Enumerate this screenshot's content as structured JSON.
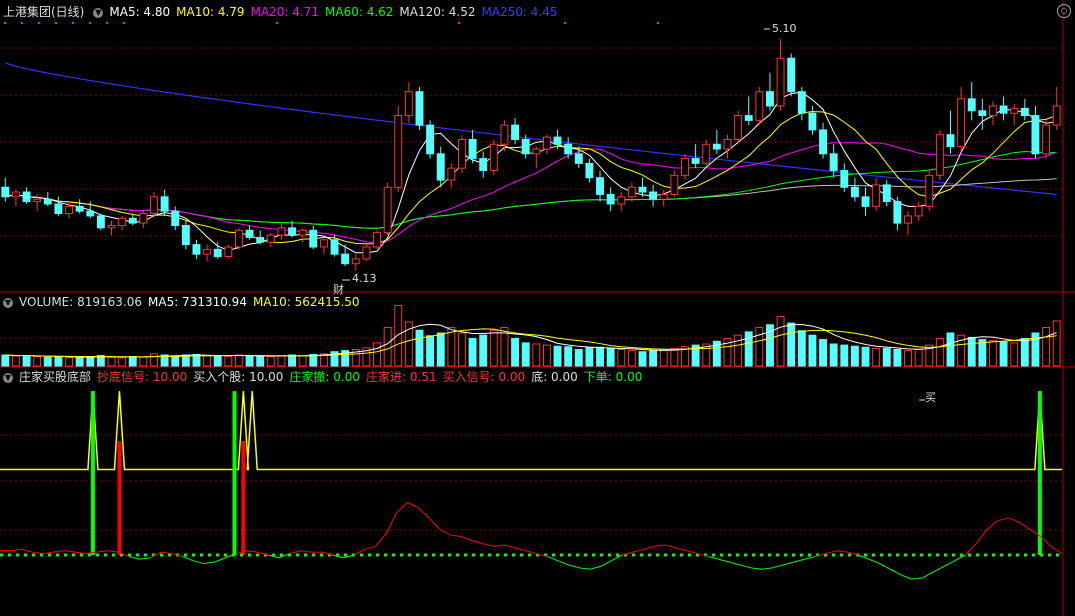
{
  "colors": {
    "up": "#ff3232",
    "down": "#54ffff",
    "ma5": "#ffffff",
    "ma10": "#ffff00",
    "ma20": "#ff00ff",
    "ma60": "#00ff00",
    "ma120": "#c0c0c0",
    "ma250": "#3333ff",
    "grid": "#8b0000",
    "yellow": "#ffff00",
    "green": "#00ff00",
    "red": "#ff0000"
  },
  "main_header": {
    "title": "上港集团(日线)",
    "ma5": "MA5: 4.80",
    "ma10": "MA10: 4.79",
    "ma20": "MA20: 4.71",
    "ma60": "MA60: 4.62",
    "ma120": "MA120: 4.52",
    "ma250": "MA250: 4.45"
  },
  "volume_header": {
    "volume": "VOLUME: 819163.06",
    "ma5": "MA5: 731310.94",
    "ma10": "MA10: 562415.50"
  },
  "indicator_header": {
    "title": "庄家买股底部",
    "cdxh": "抄底信号: 10.00",
    "mrgg": "买入个股: 10.00",
    "zjc": "庄家撤: 0.00",
    "zjj": "庄家进: 0.51",
    "mrxh": "买入信号: 0.00",
    "di": "底: 0.00",
    "xd": "下单: 0.00"
  },
  "annotations": {
    "high_price": "5.10",
    "low_price": "4.13",
    "cai_marker": "财",
    "buy_marker": "买"
  },
  "icons": {
    "collapse": "triangle-down-icon",
    "settings": "settings-icon"
  },
  "chart_data": [
    {
      "type": "candlestick",
      "title": "上港集团(日线)",
      "ylim": [
        4.05,
        5.18
      ],
      "series_note": "approx. 100 daily candles, open/high/low/close",
      "ohlc": [
        [
          4.48,
          4.52,
          4.42,
          4.44
        ],
        [
          4.44,
          4.47,
          4.4,
          4.46
        ],
        [
          4.46,
          4.48,
          4.41,
          4.42
        ],
        [
          4.42,
          4.45,
          4.38,
          4.43
        ],
        [
          4.43,
          4.46,
          4.4,
          4.41
        ],
        [
          4.41,
          4.44,
          4.36,
          4.37
        ],
        [
          4.37,
          4.42,
          4.35,
          4.4
        ],
        [
          4.4,
          4.43,
          4.37,
          4.38
        ],
        [
          4.38,
          4.42,
          4.35,
          4.36
        ],
        [
          4.36,
          4.37,
          4.3,
          4.31
        ],
        [
          4.31,
          4.34,
          4.28,
          4.32
        ],
        [
          4.32,
          4.36,
          4.3,
          4.35
        ],
        [
          4.35,
          4.37,
          4.32,
          4.33
        ],
        [
          4.33,
          4.38,
          4.31,
          4.37
        ],
        [
          4.37,
          4.46,
          4.35,
          4.44
        ],
        [
          4.44,
          4.47,
          4.36,
          4.38
        ],
        [
          4.38,
          4.4,
          4.3,
          4.32
        ],
        [
          4.32,
          4.34,
          4.22,
          4.24
        ],
        [
          4.24,
          4.26,
          4.18,
          4.2
        ],
        [
          4.2,
          4.24,
          4.17,
          4.22
        ],
        [
          4.22,
          4.25,
          4.18,
          4.19
        ],
        [
          4.19,
          4.24,
          4.18,
          4.23
        ],
        [
          4.23,
          4.31,
          4.22,
          4.3
        ],
        [
          4.3,
          4.32,
          4.26,
          4.27
        ],
        [
          4.27,
          4.3,
          4.24,
          4.25
        ],
        [
          4.25,
          4.29,
          4.23,
          4.28
        ],
        [
          4.28,
          4.33,
          4.26,
          4.31
        ],
        [
          4.31,
          4.34,
          4.27,
          4.28
        ],
        [
          4.28,
          4.31,
          4.25,
          4.3
        ],
        [
          4.3,
          4.32,
          4.22,
          4.23
        ],
        [
          4.23,
          4.27,
          4.2,
          4.26
        ],
        [
          4.26,
          4.28,
          4.19,
          4.2
        ],
        [
          4.2,
          4.24,
          4.15,
          4.16
        ],
        [
          4.16,
          4.2,
          4.13,
          4.18
        ],
        [
          4.18,
          4.24,
          4.17,
          4.23
        ],
        [
          4.23,
          4.3,
          4.22,
          4.29
        ],
        [
          4.29,
          4.5,
          4.28,
          4.48
        ],
        [
          4.48,
          4.82,
          4.46,
          4.78
        ],
        [
          4.78,
          4.92,
          4.75,
          4.88
        ],
        [
          4.88,
          4.9,
          4.72,
          4.74
        ],
        [
          4.74,
          4.76,
          4.6,
          4.62
        ],
        [
          4.62,
          4.65,
          4.48,
          4.51
        ],
        [
          4.51,
          4.58,
          4.48,
          4.56
        ],
        [
          4.56,
          4.7,
          4.54,
          4.68
        ],
        [
          4.68,
          4.72,
          4.58,
          4.6
        ],
        [
          4.6,
          4.63,
          4.52,
          4.55
        ],
        [
          4.55,
          4.68,
          4.53,
          4.66
        ],
        [
          4.66,
          4.76,
          4.63,
          4.74
        ],
        [
          4.74,
          4.77,
          4.66,
          4.68
        ],
        [
          4.68,
          4.7,
          4.6,
          4.62
        ],
        [
          4.62,
          4.65,
          4.56,
          4.64
        ],
        [
          4.64,
          4.7,
          4.62,
          4.69
        ],
        [
          4.69,
          4.72,
          4.64,
          4.66
        ],
        [
          4.66,
          4.69,
          4.6,
          4.62
        ],
        [
          4.62,
          4.65,
          4.56,
          4.58
        ],
        [
          4.58,
          4.6,
          4.5,
          4.52
        ],
        [
          4.52,
          4.55,
          4.42,
          4.45
        ],
        [
          4.45,
          4.48,
          4.38,
          4.41
        ],
        [
          4.41,
          4.46,
          4.38,
          4.44
        ],
        [
          4.44,
          4.5,
          4.42,
          4.48
        ],
        [
          4.48,
          4.52,
          4.44,
          4.46
        ],
        [
          4.46,
          4.49,
          4.4,
          4.43
        ],
        [
          4.43,
          4.47,
          4.4,
          4.45
        ],
        [
          4.45,
          4.55,
          4.44,
          4.53
        ],
        [
          4.53,
          4.62,
          4.51,
          4.6
        ],
        [
          4.6,
          4.66,
          4.56,
          4.58
        ],
        [
          4.58,
          4.68,
          4.57,
          4.66
        ],
        [
          4.66,
          4.72,
          4.62,
          4.64
        ],
        [
          4.64,
          4.7,
          4.6,
          4.68
        ],
        [
          4.68,
          4.8,
          4.66,
          4.78
        ],
        [
          4.78,
          4.86,
          4.74,
          4.76
        ],
        [
          4.76,
          4.9,
          4.74,
          4.88
        ],
        [
          4.88,
          4.96,
          4.8,
          4.82
        ],
        [
          4.82,
          5.1,
          4.8,
          5.02
        ],
        [
          5.02,
          5.04,
          4.86,
          4.88
        ],
        [
          4.88,
          4.9,
          4.76,
          4.79
        ],
        [
          4.79,
          4.82,
          4.7,
          4.72
        ],
        [
          4.72,
          4.75,
          4.6,
          4.62
        ],
        [
          4.62,
          4.66,
          4.52,
          4.55
        ],
        [
          4.55,
          4.58,
          4.46,
          4.48
        ],
        [
          4.48,
          4.52,
          4.42,
          4.44
        ],
        [
          4.44,
          4.48,
          4.36,
          4.4
        ],
        [
          4.4,
          4.52,
          4.38,
          4.49
        ],
        [
          4.49,
          4.51,
          4.4,
          4.42
        ],
        [
          4.42,
          4.44,
          4.3,
          4.33
        ],
        [
          4.33,
          4.38,
          4.28,
          4.36
        ],
        [
          4.36,
          4.42,
          4.34,
          4.4
        ],
        [
          4.4,
          4.55,
          4.38,
          4.53
        ],
        [
          4.53,
          4.72,
          4.51,
          4.7
        ],
        [
          4.7,
          4.8,
          4.62,
          4.65
        ],
        [
          4.65,
          4.9,
          4.63,
          4.85
        ],
        [
          4.85,
          4.92,
          4.76,
          4.8
        ],
        [
          4.8,
          4.85,
          4.72,
          4.78
        ],
        [
          4.78,
          4.84,
          4.74,
          4.82
        ],
        [
          4.82,
          4.86,
          4.76,
          4.79
        ],
        [
          4.79,
          4.83,
          4.74,
          4.81
        ],
        [
          4.81,
          4.85,
          4.76,
          4.78
        ],
        [
          4.78,
          4.82,
          4.6,
          4.62
        ],
        [
          4.62,
          4.76,
          4.6,
          4.74
        ],
        [
          4.74,
          4.9,
          4.72,
          4.82
        ]
      ],
      "ma_lines": [
        "MA5",
        "MA10",
        "MA20",
        "MA60",
        "MA120",
        "MA250"
      ],
      "ma250_start": 5.0,
      "ma250_end": 4.45
    },
    {
      "type": "bar",
      "title": "VOLUME",
      "ylim": [
        0,
        1200000
      ],
      "values": [
        200000,
        180000,
        190000,
        170000,
        160000,
        170000,
        150000,
        160000,
        170000,
        190000,
        160000,
        150000,
        170000,
        160000,
        220000,
        200000,
        180000,
        200000,
        210000,
        190000,
        180000,
        170000,
        200000,
        190000,
        180000,
        170000,
        180000,
        200000,
        190000,
        210000,
        220000,
        260000,
        280000,
        300000,
        330000,
        420000,
        700000,
        1100000,
        800000,
        650000,
        550000,
        600000,
        700000,
        600000,
        500000,
        560000,
        650000,
        700000,
        500000,
        420000,
        400000,
        380000,
        360000,
        350000,
        300000,
        330000,
        340000,
        320000,
        300000,
        280000,
        260000,
        280000,
        300000,
        320000,
        350000,
        380000,
        400000,
        450000,
        500000,
        560000,
        620000,
        700000,
        750000,
        900000,
        780000,
        640000,
        560000,
        480000,
        400000,
        380000,
        360000,
        340000,
        320000,
        320000,
        300000,
        280000,
        300000,
        380000,
        500000,
        600000,
        560000,
        520000,
        480000,
        460000,
        440000,
        420000,
        500000,
        600000,
        700000,
        819163
      ]
    },
    {
      "type": "line",
      "title": "庄家买股底部",
      "ylim": [
        -4,
        12
      ],
      "yellow_baseline": 6,
      "yellow_peaks": [
        10,
        13,
        27,
        28,
        117
      ],
      "green_bars": [
        10,
        26,
        117
      ],
      "red_bars": [
        13,
        27
      ],
      "red_green_curve": [
        0.3,
        0.3,
        0.4,
        0.2,
        0.1,
        0.2,
        0.3,
        0.2,
        0.1,
        0.2,
        0.3,
        0.2,
        -0.1,
        -0.3,
        -0.2,
        0.2,
        0.1,
        -0.1,
        -0.4,
        -0.6,
        -0.5,
        -0.2,
        0.1,
        0.3,
        0.2,
        0.0,
        -0.2,
        0.1,
        0.3,
        0.2,
        0.2,
        0.0,
        -0.2,
        0.0,
        0.4,
        0.6,
        1.5,
        3.0,
        3.7,
        3.3,
        2.6,
        1.8,
        1.4,
        1.3,
        1.0,
        0.8,
        0.6,
        0.7,
        0.5,
        0.3,
        0.1,
        -0.1,
        -0.4,
        -0.7,
        -0.9,
        -1.0,
        -0.8,
        -0.4,
        0.0,
        0.2,
        0.4,
        0.6,
        0.7,
        0.5,
        0.3,
        0.1,
        -0.1,
        -0.3,
        -0.5,
        -0.7,
        -0.9,
        -1.0,
        -0.9,
        -0.7,
        -0.5,
        -0.3,
        -0.1,
        0.1,
        0.3,
        0.2,
        0.0,
        -0.3,
        -0.6,
        -1.0,
        -1.4,
        -1.7,
        -1.6,
        -1.2,
        -0.8,
        -0.4,
        0.0,
        0.8,
        1.8,
        2.4,
        2.6,
        2.3,
        1.8,
        1.3,
        0.6,
        0.1
      ],
      "dotted_zero": 0
    }
  ]
}
